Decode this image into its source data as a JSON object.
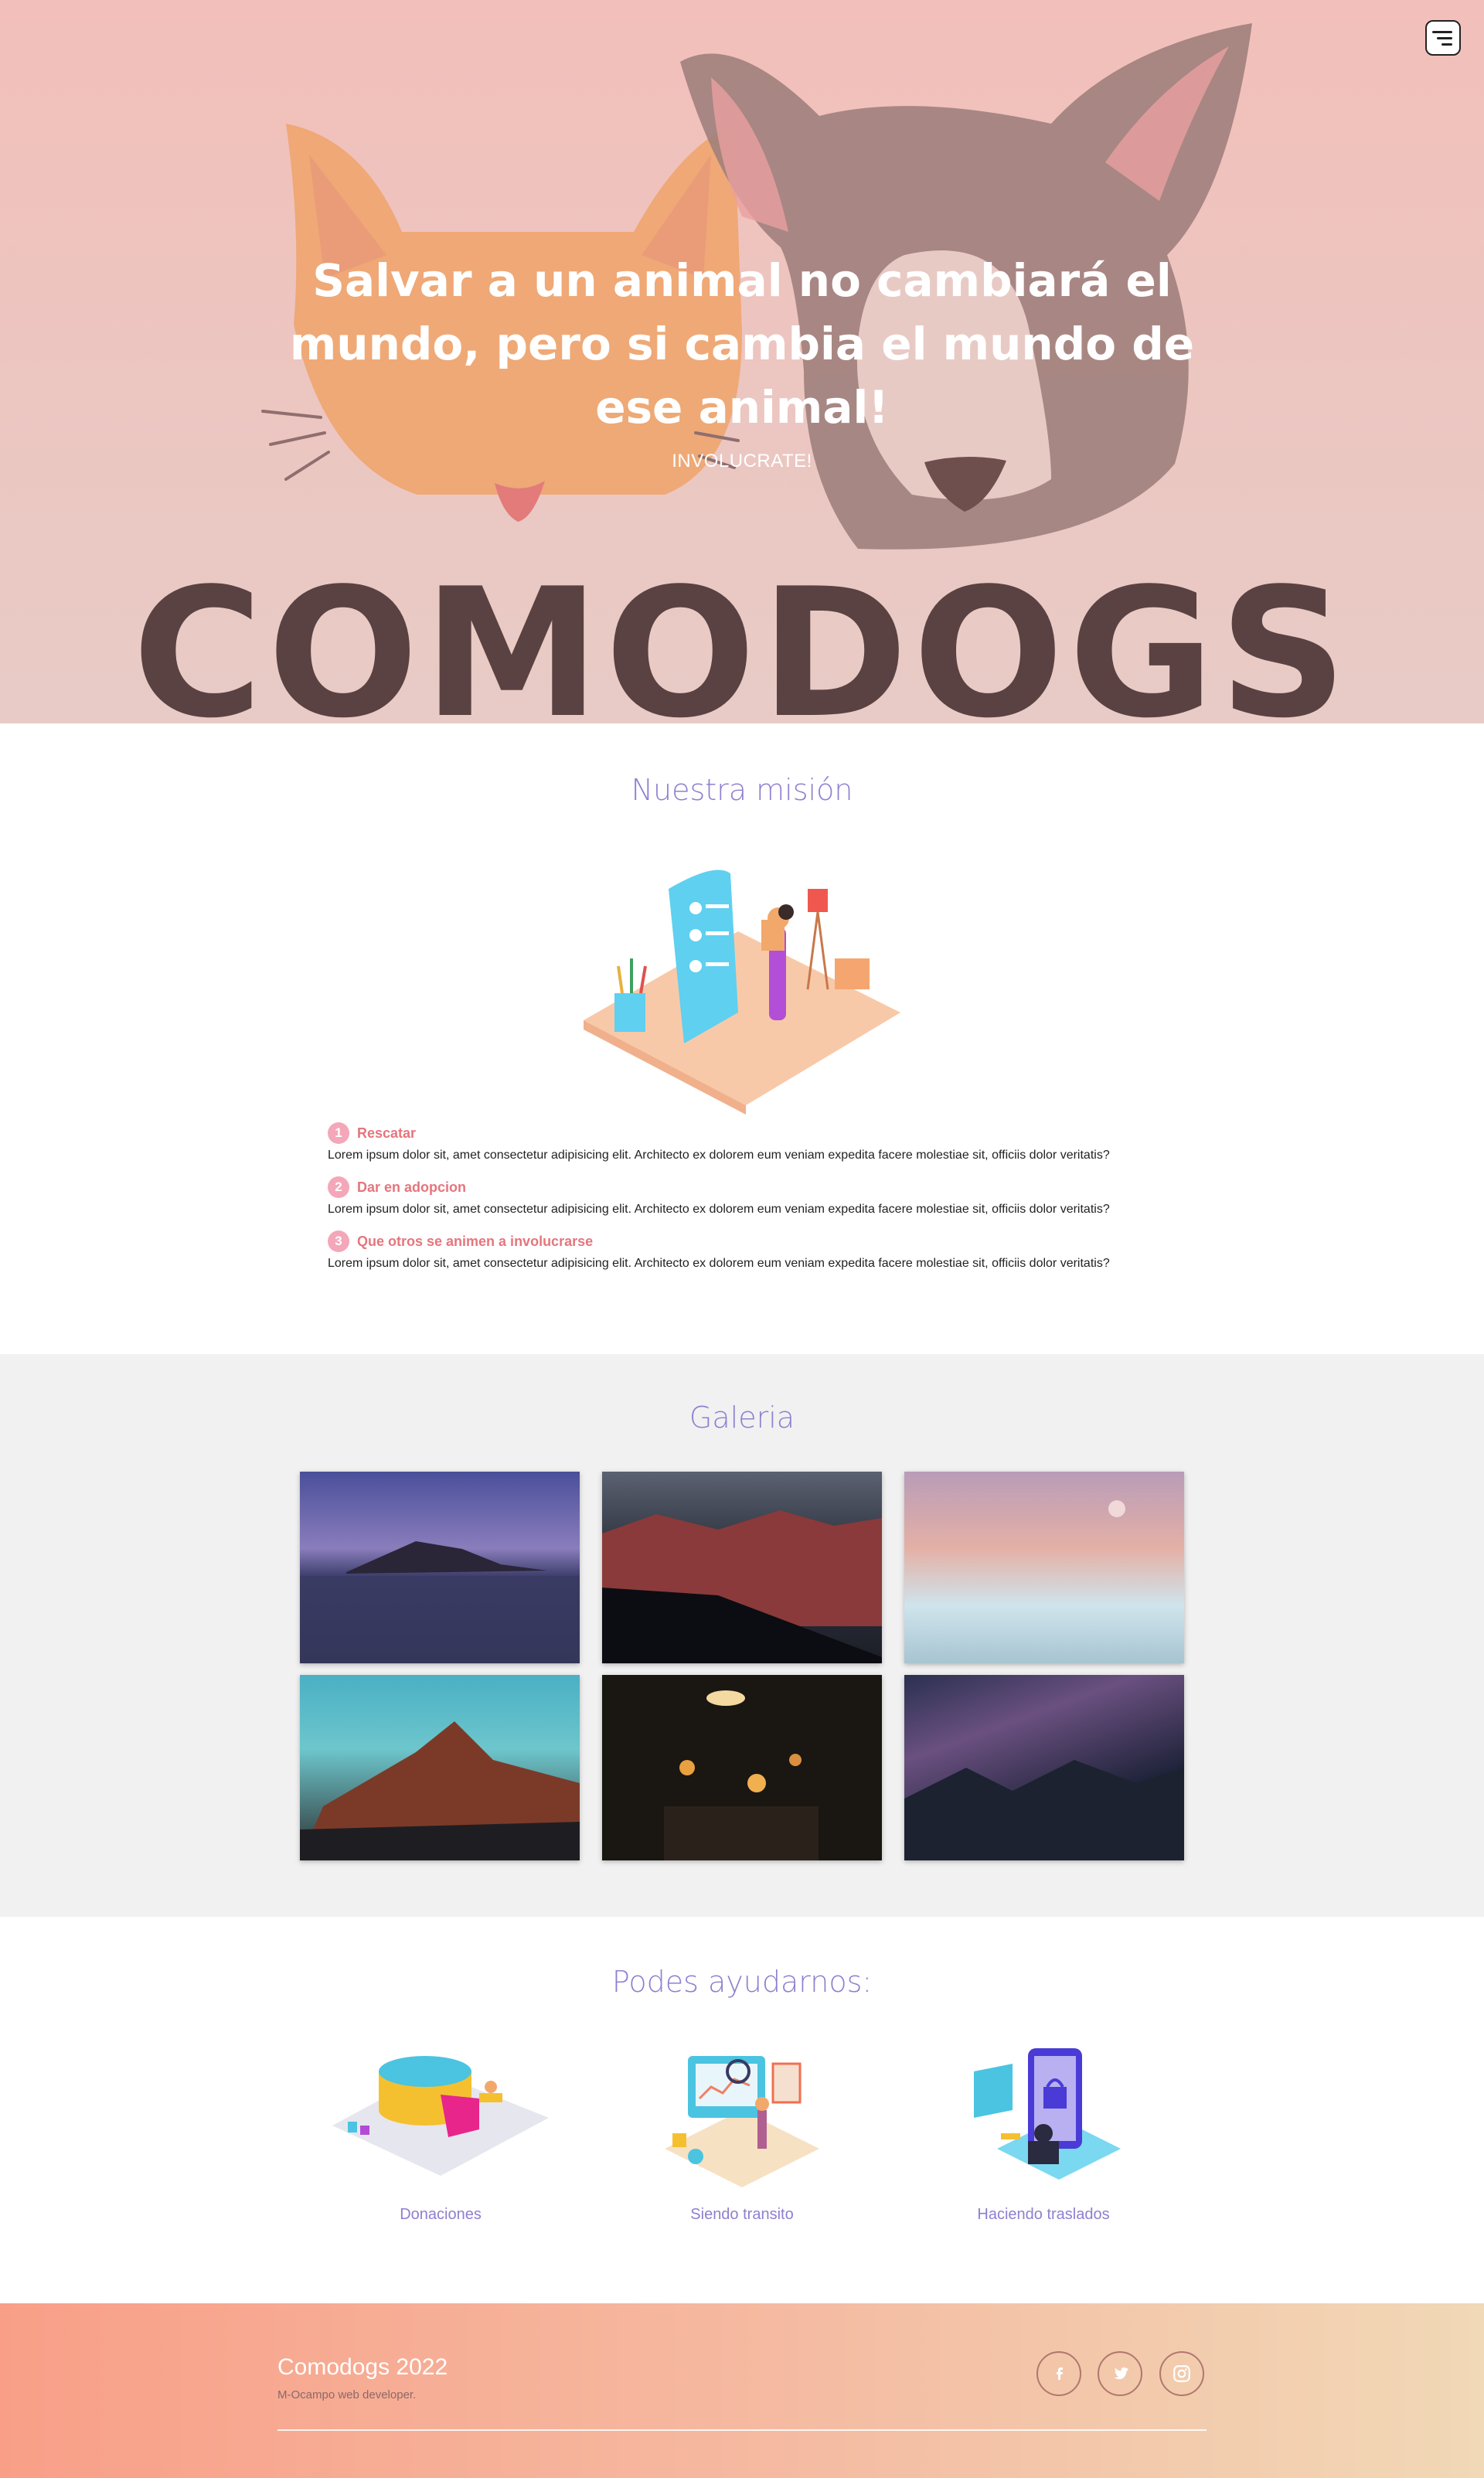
{
  "hero": {
    "title": "Salvar a un animal no cambiará el mundo, pero si cambia el mundo de ese animal!",
    "cta": "INVOLUCRATE!",
    "brand": "COMODOGS",
    "menu_icon": "menu-icon"
  },
  "mission": {
    "title": "Nuestra misión",
    "steps": [
      {
        "num": "1",
        "title": "Rescatar",
        "text": "Lorem ipsum dolor sit, amet consectetur adipisicing elit. Architecto ex dolorem eum veniam expedita facere molestiae sit, officiis dolor veritatis?"
      },
      {
        "num": "2",
        "title": "Dar en adopcion",
        "text": "Lorem ipsum dolor sit, amet consectetur adipisicing elit. Architecto ex dolorem eum veniam expedita facere molestiae sit, officiis dolor veritatis?"
      },
      {
        "num": "3",
        "title": "Que otros se animen a involucrarse",
        "text": "Lorem ipsum dolor sit, amet consectetur adipisicing elit. Architecto ex dolorem eum veniam expedita facere molestiae sit, officiis dolor veritatis?"
      }
    ]
  },
  "gallery": {
    "title": "Galeria"
  },
  "help": {
    "title": "Podes ayudarnos:",
    "items": [
      {
        "label": "Donaciones"
      },
      {
        "label": "Siendo transito"
      },
      {
        "label": "Haciendo traslados"
      }
    ]
  },
  "footer": {
    "title": "Comodogs 2022",
    "subtitle": "M-Ocampo web developer.",
    "social": [
      "facebook-icon",
      "twitter-icon",
      "instagram-icon"
    ]
  },
  "colors": {
    "accent_purple": "#8f7fd0",
    "step_pink": "#e6757d",
    "hero_bg": "#f3bfba",
    "footer_start": "#f99f88",
    "footer_end": "#f1d8b6"
  }
}
